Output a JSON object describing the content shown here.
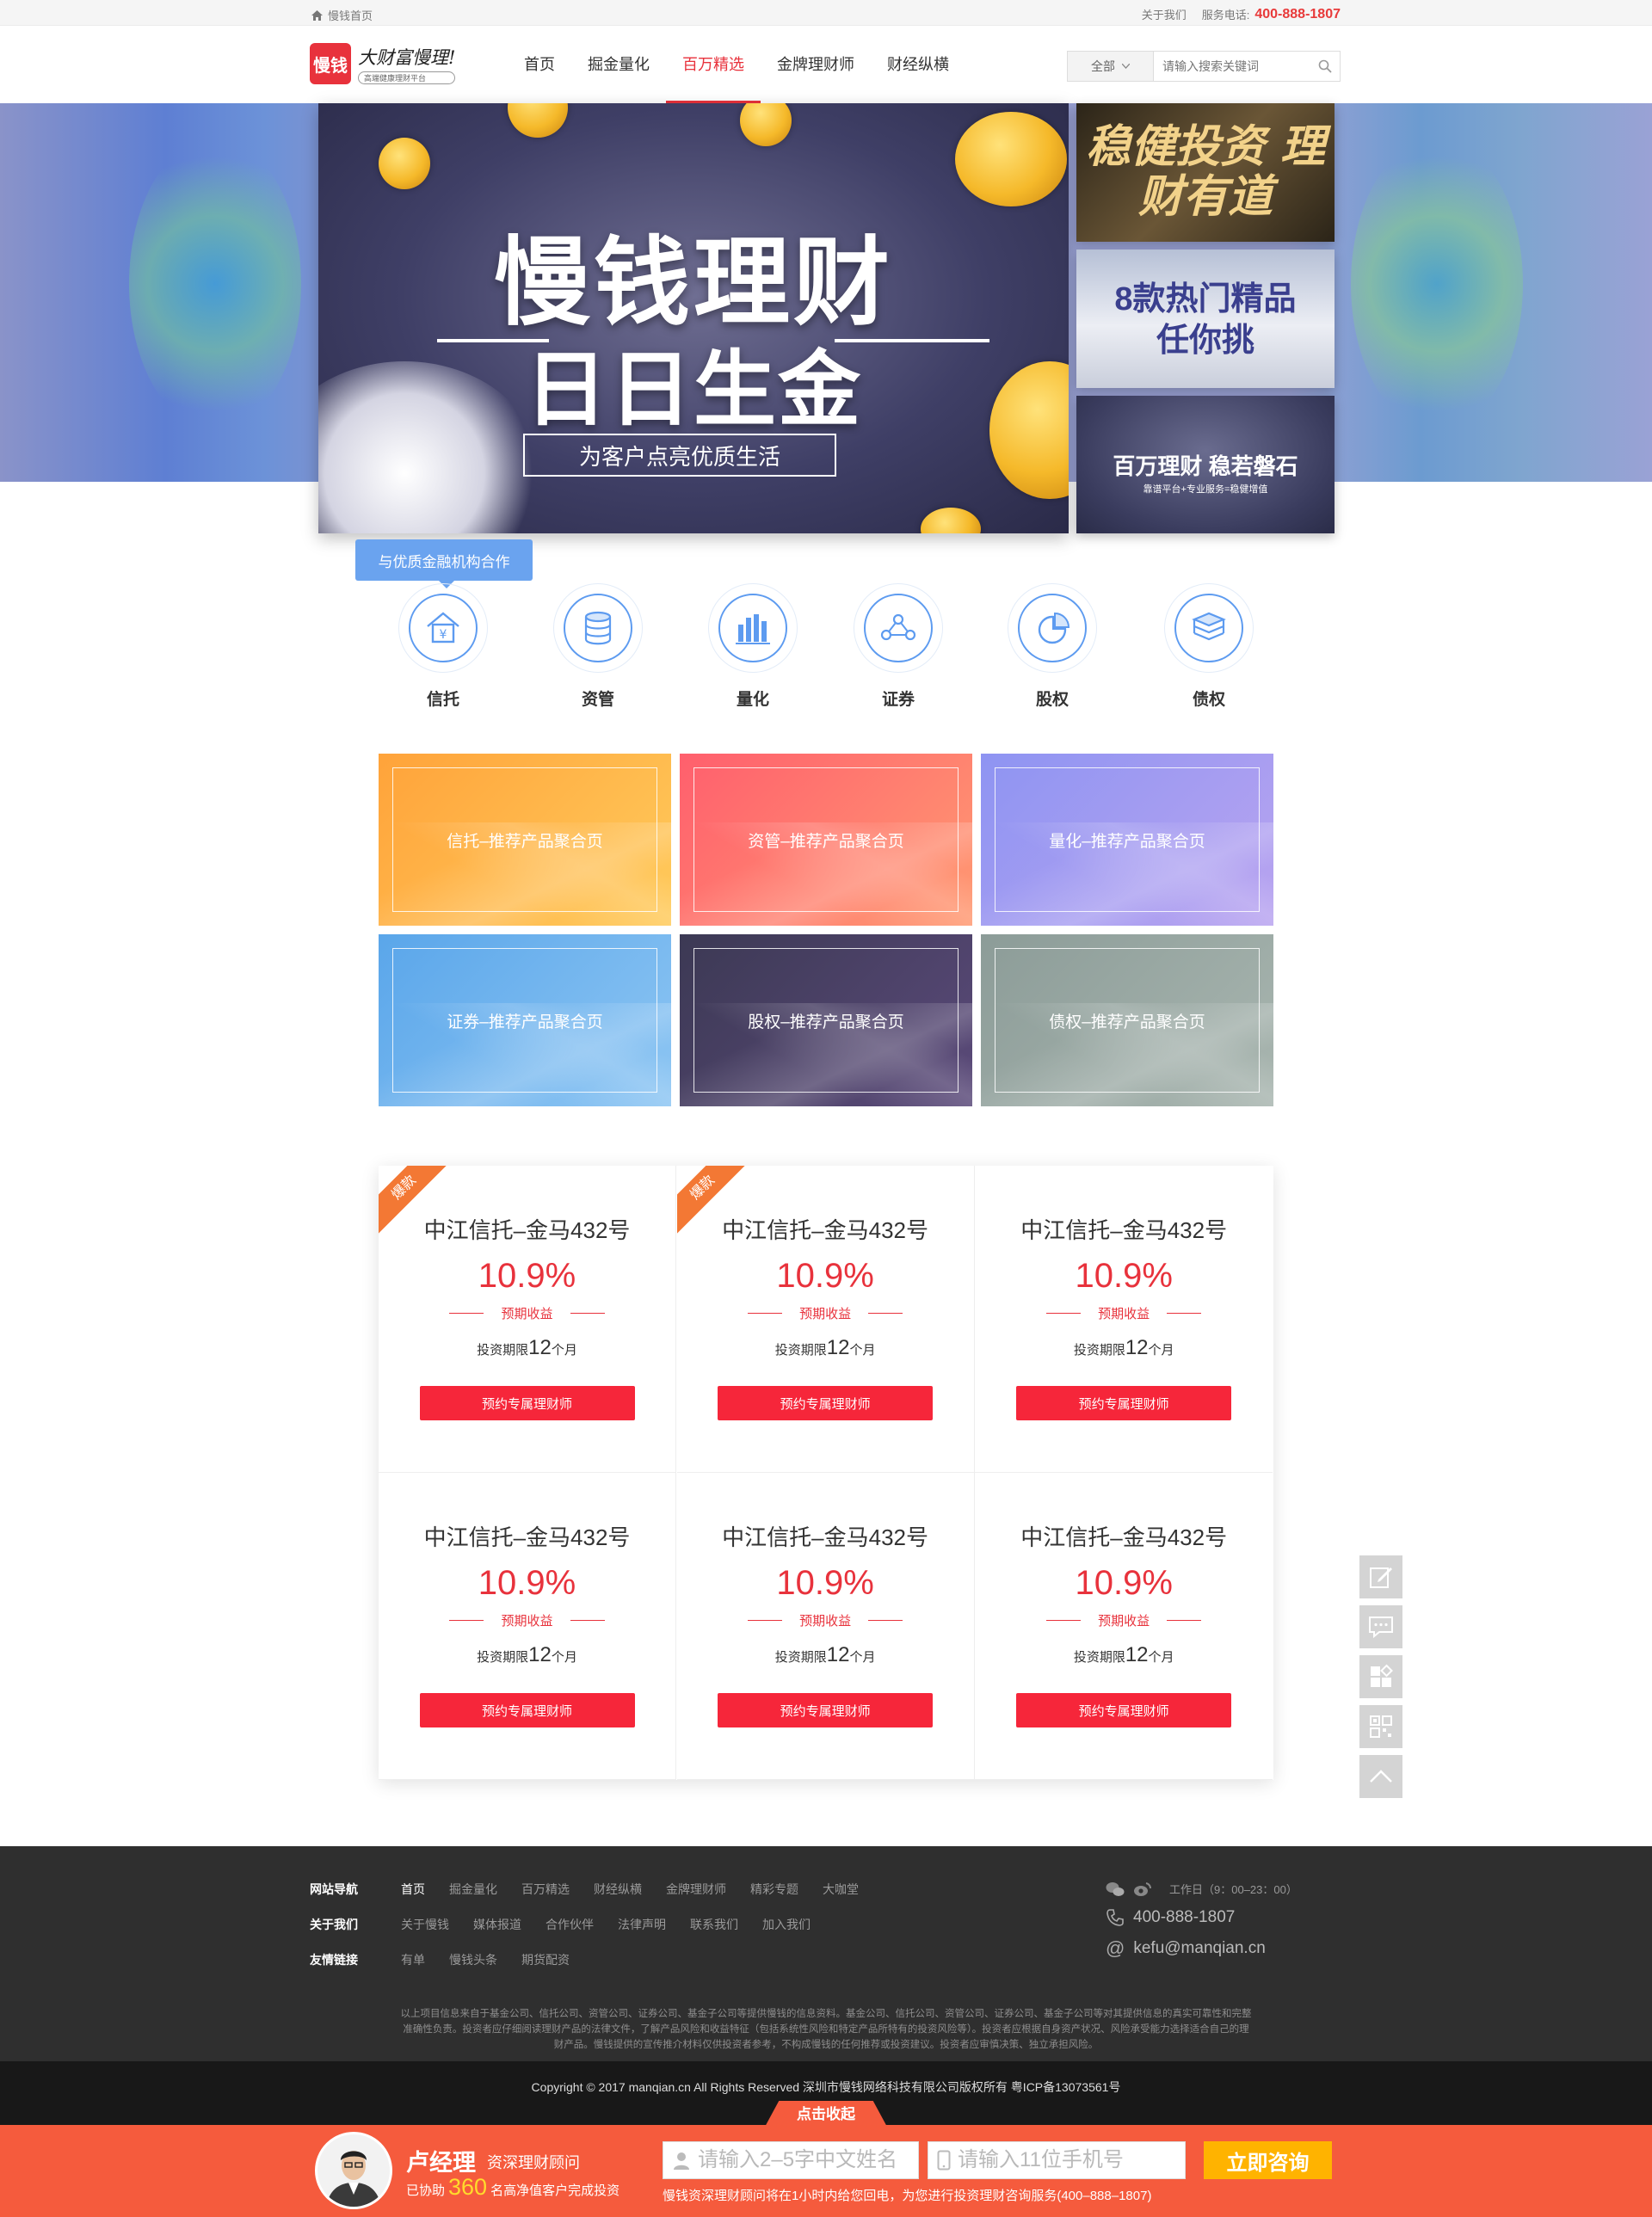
{
  "topbar": {
    "home_label": "慢钱首页",
    "about_label": "关于我们",
    "phone_label": "服务电话:",
    "phone": "400-888-1807"
  },
  "header": {
    "logo_mark": "慢钱",
    "logo_slogan": "大财富慢理!",
    "logo_sub": "高端健康理财平台",
    "nav": [
      {
        "label": "首页"
      },
      {
        "label": "掘金量化"
      },
      {
        "label": "百万精选",
        "active": true
      },
      {
        "label": "金牌理财师"
      },
      {
        "label": "财经纵横"
      }
    ],
    "search_select": "全部",
    "search_placeholder": "请输入搜索关键词"
  },
  "banner": {
    "title": "慢钱理财",
    "subtitle": "日日生金",
    "tagline": "为客户点亮优质生活",
    "side1": "稳健投资 理财有道",
    "side2_line1": "8款热门精品",
    "side2_line2": "任你挑",
    "side3": "百万理财 稳若磐石",
    "side3_sub": "靠谱平台+专业服务=稳健增值"
  },
  "categories": {
    "coop_label": "与优质金融机构合作",
    "items": [
      {
        "label": "信托",
        "icon": "trust-house-icon"
      },
      {
        "label": "资管",
        "icon": "coin-stack-icon"
      },
      {
        "label": "量化",
        "icon": "bar-chart-icon"
      },
      {
        "label": "证券",
        "icon": "network-nodes-icon"
      },
      {
        "label": "股权",
        "icon": "pie-chart-icon"
      },
      {
        "label": "债权",
        "icon": "layers-icon"
      }
    ]
  },
  "tiles": [
    {
      "label": "信托–推荐产品聚合页",
      "color_from": "#ffa33a",
      "color_to": "#ffcb5c"
    },
    {
      "label": "资管–推荐产品聚合页",
      "color_from": "#ff5f6d",
      "color_to": "#ff9a72"
    },
    {
      "label": "量化–推荐产品聚合页",
      "color_from": "#8e94f2",
      "color_to": "#b9a4f0"
    },
    {
      "label": "证券–推荐产品聚合页",
      "color_from": "#5aa6ea",
      "color_to": "#8ec6f3"
    },
    {
      "label": "股权–推荐产品聚合页",
      "color_from": "#3c3954",
      "color_to": "#5b4a7a"
    },
    {
      "label": "债权–推荐产品聚合页",
      "color_from": "#8c9c98",
      "color_to": "#a9b6b0"
    }
  ],
  "products": [
    {
      "name": "中江信托–金马432号",
      "rate": "10.9%",
      "rate_label": "预期收益",
      "term_prefix": "投资期限",
      "term_value": "12",
      "term_unit": "个月",
      "button": "预约专属理财师",
      "badge": "爆款"
    },
    {
      "name": "中江信托–金马432号",
      "rate": "10.9%",
      "rate_label": "预期收益",
      "term_prefix": "投资期限",
      "term_value": "12",
      "term_unit": "个月",
      "button": "预约专属理财师",
      "badge": "爆款"
    },
    {
      "name": "中江信托–金马432号",
      "rate": "10.9%",
      "rate_label": "预期收益",
      "term_prefix": "投资期限",
      "term_value": "12",
      "term_unit": "个月",
      "button": "预约专属理财师",
      "badge": ""
    },
    {
      "name": "中江信托–金马432号",
      "rate": "10.9%",
      "rate_label": "预期收益",
      "term_prefix": "投资期限",
      "term_value": "12",
      "term_unit": "个月",
      "button": "预约专属理财师",
      "badge": ""
    },
    {
      "name": "中江信托–金马432号",
      "rate": "10.9%",
      "rate_label": "预期收益",
      "term_prefix": "投资期限",
      "term_value": "12",
      "term_unit": "个月",
      "button": "预约专属理财师",
      "badge": ""
    },
    {
      "name": "中江信托–金马432号",
      "rate": "10.9%",
      "rate_label": "预期收益",
      "term_prefix": "投资期限",
      "term_value": "12",
      "term_unit": "个月",
      "button": "预约专属理财师",
      "badge": ""
    }
  ],
  "float_tools": [
    "edit-icon",
    "chat-icon",
    "apps-icon",
    "qrcode-icon",
    "back-to-top-icon"
  ],
  "footer": {
    "rows": [
      {
        "heading": "网站导航",
        "links": [
          "首页",
          "掘金量化",
          "百万精选",
          "财经纵横",
          "金牌理财师",
          "精彩专题",
          "大咖堂"
        ]
      },
      {
        "heading": "关于我们",
        "links": [
          "关于慢钱",
          "媒体报道",
          "合作伙伴",
          "法律声明",
          "联系我们",
          "加入我们"
        ]
      },
      {
        "heading": "友情链接",
        "links": [
          "有单",
          "慢钱头条",
          "期货配资"
        ]
      }
    ],
    "hours": "工作日（9：00–23：00）",
    "phone": "400-888-1807",
    "email": "kefu@manqian.cn",
    "disclaimer": "以上项目信息来自于基金公司、信托公司、资管公司、证券公司、基金子公司等提供慢钱的信息资料。基金公司、信托公司、资管公司、证券公司、基金子公司等对其提供信息的真实可靠性和完整准确性负责。投资者应仔细阅读理财产品的法律文件，了解产品风险和收益特征（包括系统性风险和特定产品所特有的投资风险等）。投资者应根据自身资产状况、风险承受能力选择适合自己的理财产品。慢钱提供的宣传推介材料仅供投资者参考，不构成慢钱的任何推荐或投资建议。投资者应审慎决策、独立承担风险。",
    "copyright": "Copyright © 2017 manqian.cn All Rights Reserved 深圳市慢钱网络科技有限公司版权所有 粤ICP备13073561号"
  },
  "consult": {
    "collapse_label": "点击收起",
    "name": "卢经理",
    "title": "资深理财顾问",
    "help_prefix": "已协助",
    "help_count": "360",
    "help_suffix": "名高净值客户完成投资",
    "name_placeholder": "请输入2–5字中文姓名",
    "phone_placeholder": "请输入11位手机号",
    "button": "立即咨询",
    "note": "慢钱资深理财顾问将在1小时内给您回电，为您进行投资理财咨询服务(400–888–1807)"
  }
}
